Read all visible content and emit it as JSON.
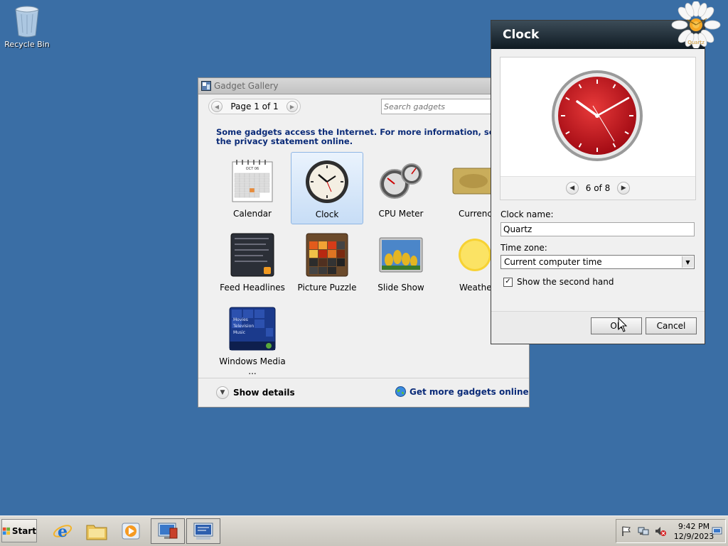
{
  "desktop": {
    "recycle_bin_label": "Recycle Bin"
  },
  "gallery": {
    "title": "Gadget Gallery",
    "page_label": "Page 1 of 1",
    "search_placeholder": "Search gadgets",
    "notice": "Some gadgets access the Internet.  For more information, see the privacy statement online.",
    "gadgets": [
      {
        "label": "Calendar",
        "icon": "calendar-icon",
        "selected": false
      },
      {
        "label": "Clock",
        "icon": "clock-icon",
        "selected": true
      },
      {
        "label": "CPU Meter",
        "icon": "cpu-meter-icon",
        "selected": false
      },
      {
        "label": "Currency",
        "icon": "currency-icon",
        "selected": false
      },
      {
        "label": "Feed Headlines",
        "icon": "feed-headlines-icon",
        "selected": false
      },
      {
        "label": "Picture Puzzle",
        "icon": "picture-puzzle-icon",
        "selected": false
      },
      {
        "label": "Slide Show",
        "icon": "slide-show-icon",
        "selected": false
      },
      {
        "label": "Weather",
        "icon": "weather-icon",
        "selected": false
      },
      {
        "label": "Windows Media ...",
        "icon": "windows-media-center-icon",
        "selected": false
      }
    ],
    "show_details": "Show details",
    "get_more": "Get more gadgets online"
  },
  "calendar_thumb": {
    "month": "OCT 06"
  },
  "media_thumb": {
    "lines": [
      "Movies",
      "Television",
      "Music"
    ]
  },
  "clock_window": {
    "title": "Clock",
    "preview_index": "6 of 8",
    "clock_name_label": "Clock name:",
    "clock_name_value": "Quartz",
    "time_zone_label": "Time zone:",
    "time_zone_value": "Current computer time",
    "second_hand_label": "Show the second hand",
    "second_hand_checked": true,
    "ok_label": "OK",
    "cancel_label": "Cancel",
    "desktop_gadget_label": "Quartz",
    "accent_color": "#c8102e"
  },
  "taskbar": {
    "start_label": "Start",
    "quick_launch": [
      "internet-explorer-icon",
      "windows-explorer-icon",
      "media-player-icon",
      "server-manager-icon",
      "remote-desktop-icon"
    ],
    "tray_icons": [
      "action-center-flag-icon",
      "network-icon",
      "volume-muted-icon"
    ],
    "time": "9:42 PM",
    "date": "12/9/2023"
  }
}
